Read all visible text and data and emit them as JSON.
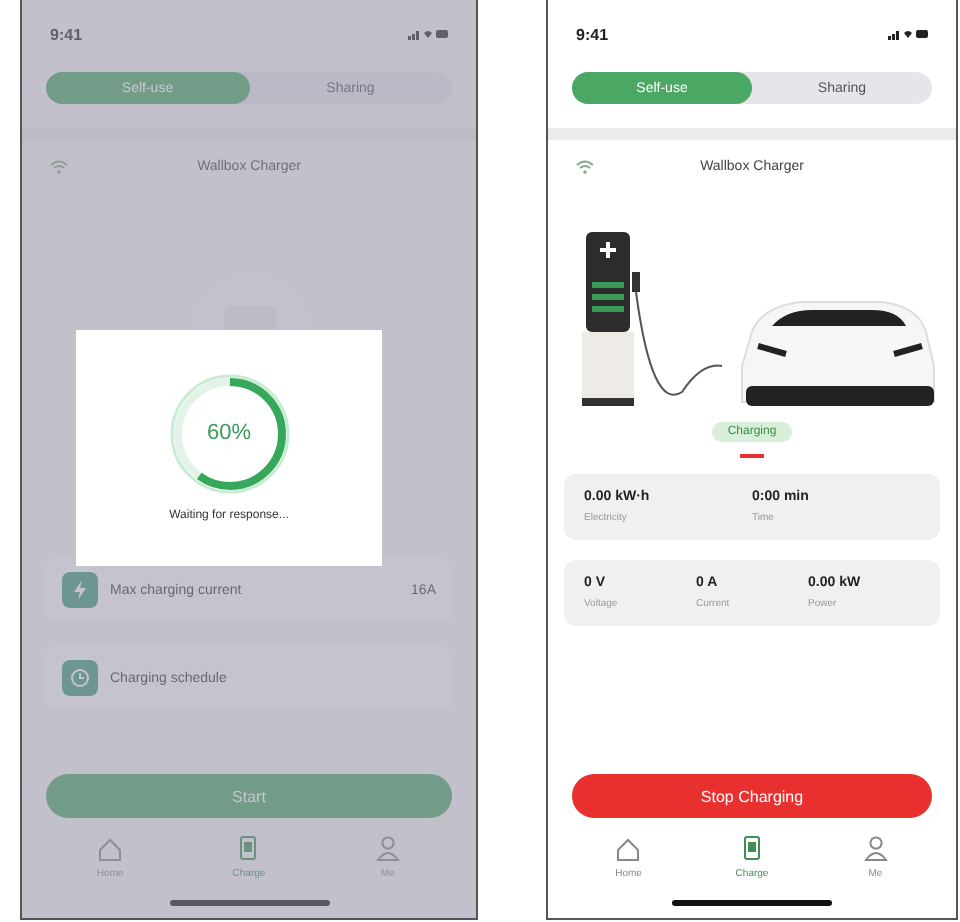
{
  "left_screen": {
    "status_time": "9:41",
    "tabs": [
      {
        "label": "Self-use",
        "selected": true
      },
      {
        "label": "Sharing",
        "selected": false
      }
    ],
    "device_name": "Wallbox Charger",
    "settings": [
      {
        "label": "Max charging current",
        "value": "16A"
      },
      {
        "label": "Charging schedule"
      }
    ],
    "action_button": {
      "label": "Start",
      "kind": "start"
    },
    "nav": [
      {
        "label": "Home",
        "selected": false
      },
      {
        "label": "Charge",
        "selected": true
      },
      {
        "label": "Me",
        "selected": false
      }
    ],
    "dialog": {
      "progress_label": "60%",
      "level": 0.6,
      "message": "Waiting for response..."
    }
  },
  "right_screen": {
    "status_time": "9:41",
    "tabs": [
      {
        "label": "Self-use",
        "selected": true
      },
      {
        "label": "Sharing",
        "selected": false
      }
    ],
    "device_name": "Wallbox Charger",
    "state_badge": "Charging",
    "stat_cards": [
      [
        {
          "value": "0.00 kW·h",
          "label": "Electricity"
        },
        {
          "value": "0:00 min",
          "label": "Time"
        }
      ],
      [
        {
          "value": "0 V",
          "label": "Voltage"
        },
        {
          "value": "0 A",
          "label": "Current"
        },
        {
          "value": "0.00 kW",
          "label": "Power"
        }
      ]
    ],
    "action_button": {
      "label": "Stop Charging",
      "kind": "stop"
    },
    "nav": [
      {
        "label": "Home",
        "selected": false
      },
      {
        "label": "Charge",
        "selected": true
      },
      {
        "label": "Me",
        "selected": false
      }
    ]
  }
}
